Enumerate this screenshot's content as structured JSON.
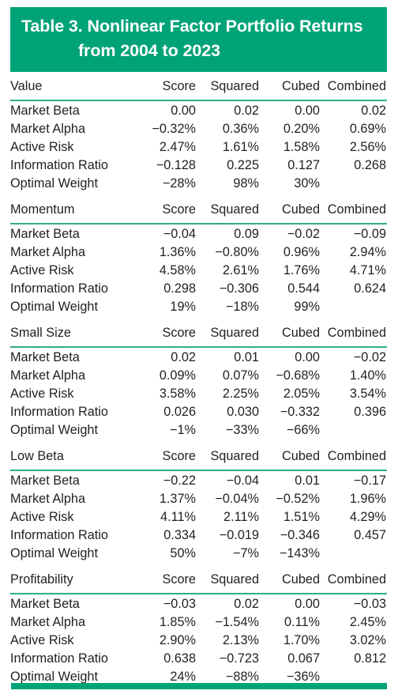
{
  "title": {
    "line1": "Table 3.  Nonlinear Factor Portfolio Returns",
    "line2": "from 2004 to 2023"
  },
  "colors": {
    "banner_green": "#00a377",
    "rule_green": "#2eae82",
    "text": "#231f20"
  },
  "columns": [
    "Score",
    "Squared",
    "Cubed",
    "Combined"
  ],
  "row_labels": [
    "Market Beta",
    "Market Alpha",
    "Active Risk",
    "Information Ratio",
    "Optimal Weight"
  ],
  "chart_data": {
    "type": "table",
    "title": "Table 3.  Nonlinear Factor Portfolio Returns from 2004 to 2023",
    "columns": [
      "Score",
      "Squared",
      "Cubed",
      "Combined"
    ],
    "sections": [
      {
        "name": "Value",
        "rows": [
          {
            "label": "Market Beta",
            "values": [
              "0.00",
              "0.02",
              "0.00",
              "0.02"
            ]
          },
          {
            "label": "Market Alpha",
            "values": [
              "−0.32%",
              "0.36%",
              "0.20%",
              "0.69%"
            ]
          },
          {
            "label": "Active Risk",
            "values": [
              "2.47%",
              "1.61%",
              "1.58%",
              "2.56%"
            ]
          },
          {
            "label": "Information Ratio",
            "values": [
              "−0.128",
              "0.225",
              "0.127",
              "0.268"
            ]
          },
          {
            "label": "Optimal Weight",
            "values": [
              "−28%",
              "98%",
              "30%",
              ""
            ]
          }
        ]
      },
      {
        "name": "Momentum",
        "rows": [
          {
            "label": "Market Beta",
            "values": [
              "−0.04",
              "0.09",
              "−0.02",
              "−0.09"
            ]
          },
          {
            "label": "Market Alpha",
            "values": [
              "1.36%",
              "−0.80%",
              "0.96%",
              "2.94%"
            ]
          },
          {
            "label": "Active Risk",
            "values": [
              "4.58%",
              "2.61%",
              "1.76%",
              "4.71%"
            ]
          },
          {
            "label": "Information Ratio",
            "values": [
              "0.298",
              "−0.306",
              "0.544",
              "0.624"
            ]
          },
          {
            "label": "Optimal Weight",
            "values": [
              "19%",
              "−18%",
              "99%",
              ""
            ]
          }
        ]
      },
      {
        "name": "Small Size",
        "rows": [
          {
            "label": "Market Beta",
            "values": [
              "0.02",
              "0.01",
              "0.00",
              "−0.02"
            ]
          },
          {
            "label": "Market Alpha",
            "values": [
              "0.09%",
              "0.07%",
              "−0.68%",
              "1.40%"
            ]
          },
          {
            "label": "Active Risk",
            "values": [
              "3.58%",
              "2.25%",
              "2.05%",
              "3.54%"
            ]
          },
          {
            "label": "Information Ratio",
            "values": [
              "0.026",
              "0.030",
              "−0.332",
              "0.396"
            ]
          },
          {
            "label": "Optimal Weight",
            "values": [
              "−1%",
              "−33%",
              "−66%",
              ""
            ]
          }
        ]
      },
      {
        "name": "Low Beta",
        "rows": [
          {
            "label": "Market Beta",
            "values": [
              "−0.22",
              "−0.04",
              "0.01",
              "−0.17"
            ]
          },
          {
            "label": "Market Alpha",
            "values": [
              "1.37%",
              "−0.04%",
              "−0.52%",
              "1.96%"
            ]
          },
          {
            "label": "Active Risk",
            "values": [
              "4.11%",
              "2.11%",
              "1.51%",
              "4.29%"
            ]
          },
          {
            "label": "Information Ratio",
            "values": [
              "0.334",
              "−0.019",
              "−0.346",
              "0.457"
            ]
          },
          {
            "label": "Optimal Weight",
            "values": [
              "50%",
              "−7%",
              "−143%",
              ""
            ]
          }
        ]
      },
      {
        "name": "Profitability",
        "rows": [
          {
            "label": "Market Beta",
            "values": [
              "−0.03",
              "0.02",
              "0.00",
              "−0.03"
            ]
          },
          {
            "label": "Market Alpha",
            "values": [
              "1.85%",
              "−1.54%",
              "0.11%",
              "2.45%"
            ]
          },
          {
            "label": "Active Risk",
            "values": [
              "2.90%",
              "2.13%",
              "1.70%",
              "3.02%"
            ]
          },
          {
            "label": "Information Ratio",
            "values": [
              "0.638",
              "−0.723",
              "0.067",
              "0.812"
            ]
          },
          {
            "label": "Optimal Weight",
            "values": [
              "24%",
              "−88%",
              "−36%",
              ""
            ]
          }
        ]
      }
    ]
  }
}
